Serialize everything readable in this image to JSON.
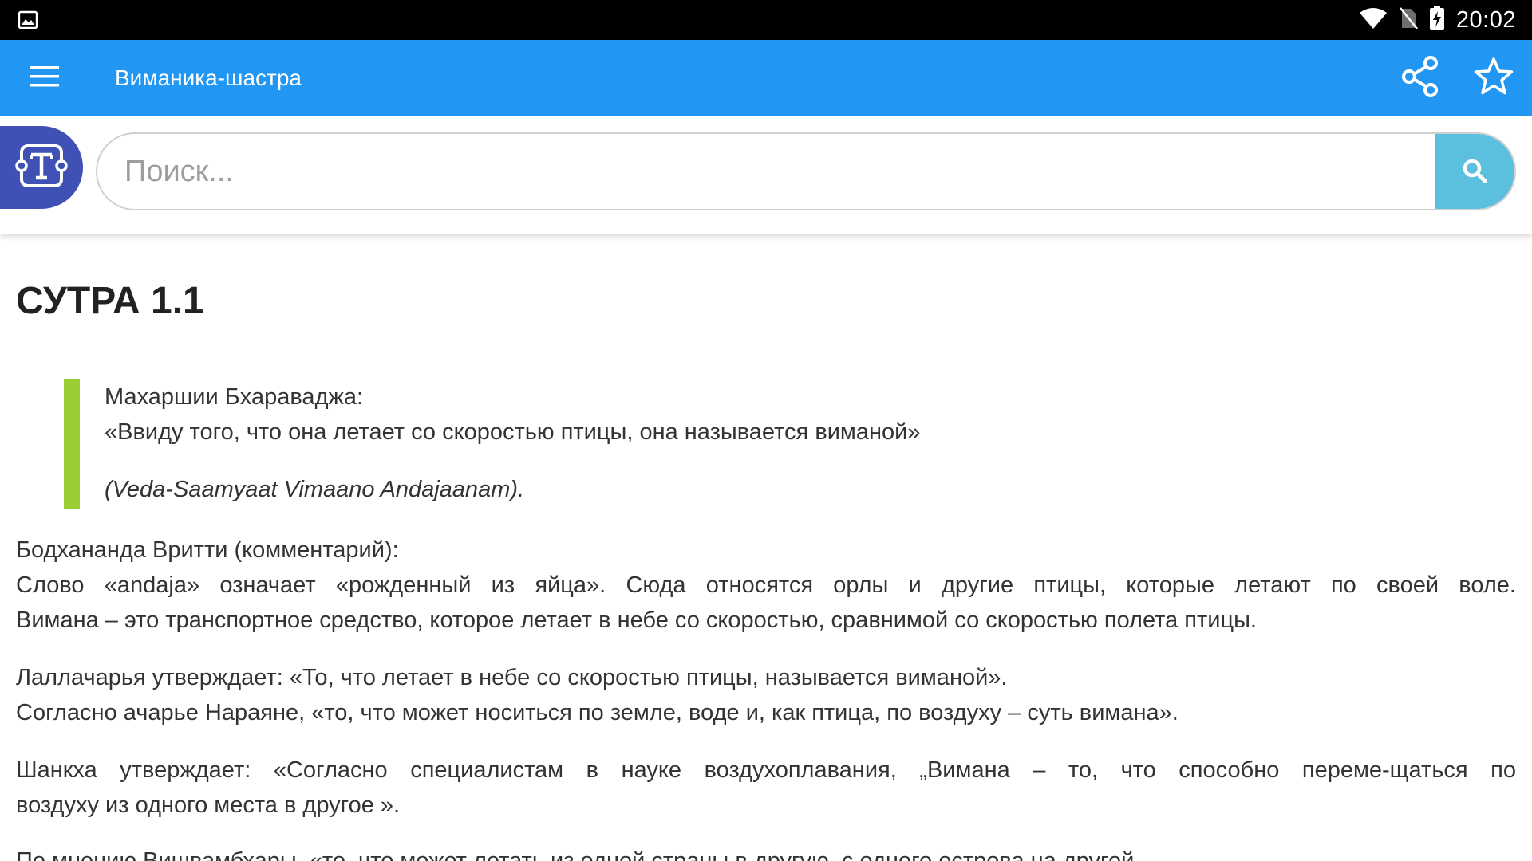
{
  "status_bar": {
    "time": "20:02",
    "icons": [
      "image-icon",
      "wifi-icon",
      "no-sim-icon",
      "battery-charging-icon"
    ]
  },
  "app_bar": {
    "title": "Виманика-шастра",
    "background_color": "#2196f3",
    "icons": [
      "menu-icon",
      "share-icon",
      "star-icon"
    ]
  },
  "search": {
    "placeholder": "Поиск...",
    "value": "",
    "button_color": "#5bc0de",
    "icon": "search-icon"
  },
  "tool_badge": {
    "icon": "text-tool-icon",
    "color": "#3f51b5"
  },
  "article": {
    "heading": "СУТРА 1.1",
    "quote": {
      "bar_color": "#9acd32",
      "line1": "Махаршии Бхараваджа:",
      "line2": "«Ввиду того, что она летает со скоростью птицы, она называется виманой»",
      "source": "(Veda-Saamyaat Vimaano Andajaanam)."
    },
    "paragraphs": [
      {
        "lines": [
          "Бодхананда Вритти (комментарий):",
          "Слово «andaja» означает «рожденный из яйца». Сюда относятся орлы и другие птицы, которые летают по своей воле.",
          "Вимана – это транспортное средство, которое летает в небе со скоростью, сравнимой со скоростью полета птицы."
        ]
      },
      {
        "lines": [
          "Лаллачарья утверждает: «То, что летает в небе со скоростью птицы, называется виманой».",
          "Согласно ачарье Нараяне, «то, что может носиться по земле, воде и, как птица, по воздуху – суть вимана»."
        ]
      },
      {
        "lines": [
          "Шанкха утверждает: «Согласно специалистам в науке воздухоплавания, „Вимана – то, что способно переме-щаться по",
          "воздуху из одного места в другое »."
        ]
      },
      {
        "lines": [
          "По мнению Вишвамбхары, «то, что может летать из одной страны в другую, с одного острова на другой"
        ]
      }
    ]
  }
}
